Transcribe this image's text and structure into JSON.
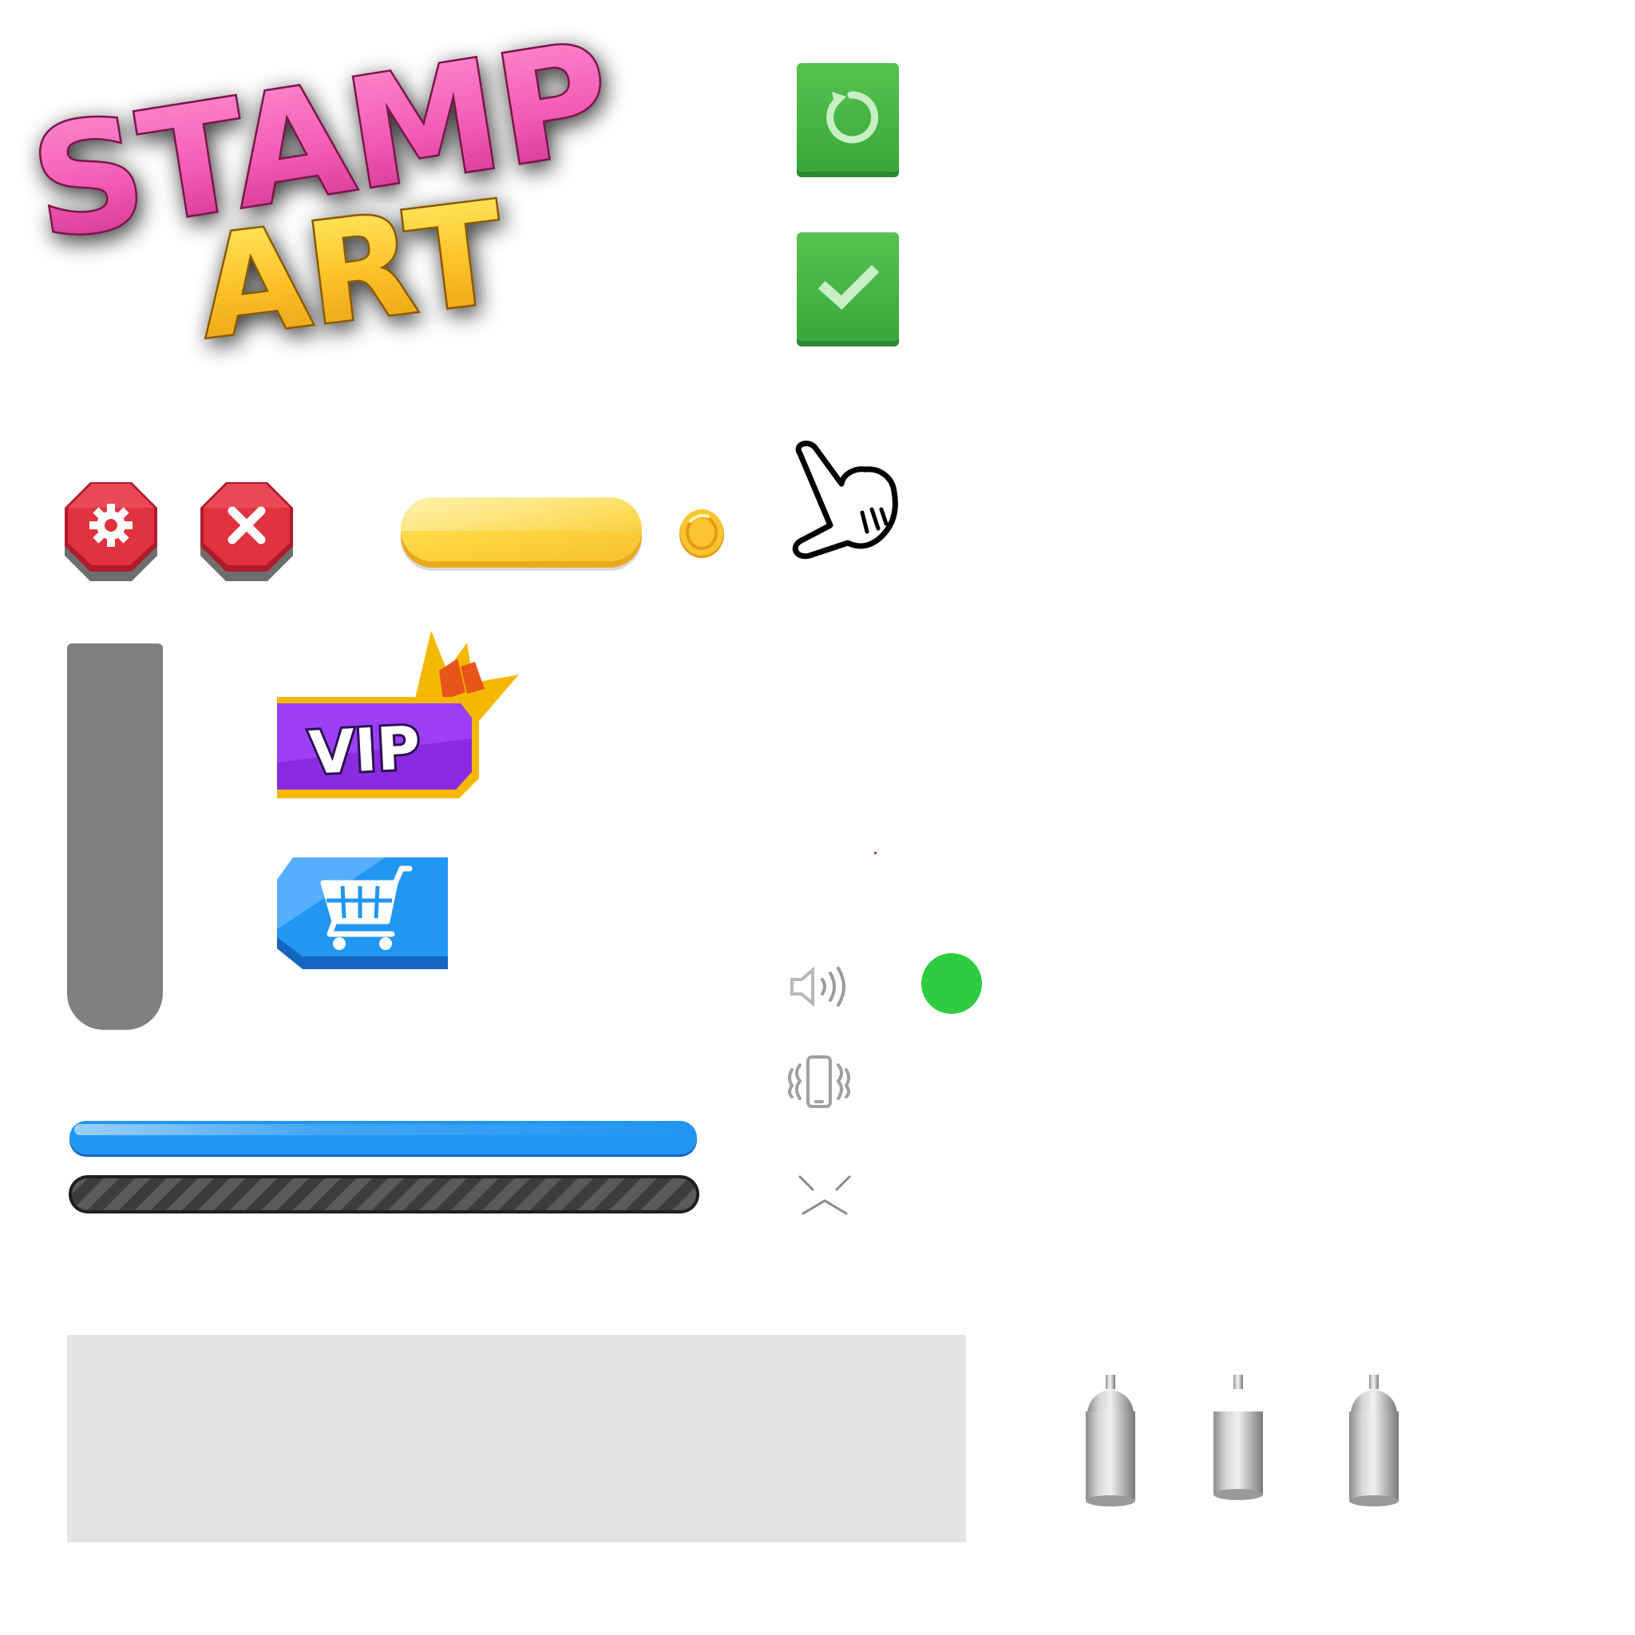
{
  "logo": {
    "line1": "STAMP",
    "line2": "ART"
  },
  "vip_badge": {
    "label": "VIP"
  },
  "colors": {
    "logo_pink": "#f25bb5",
    "logo_gold": "#fdc32a",
    "green_button": "#46b444",
    "red_button": "#d7263d",
    "yellow_pill": "#fdd640",
    "vip_purple": "#8a2be2",
    "cart_blue": "#2196f3",
    "progress_blue": "#2196f3",
    "grey_bar": "#808080",
    "toggle_dot": "#2ecc40",
    "panel_grey": "#e4e4e4"
  },
  "icons": [
    "restart-icon",
    "check-icon",
    "pointing-hand-icon",
    "gear-icon",
    "close-icon",
    "coin-icon",
    "crown-icon",
    "cart-icon",
    "sound-icon",
    "vibrate-icon",
    "chevron-down-icon",
    "spray-can-icon"
  ]
}
